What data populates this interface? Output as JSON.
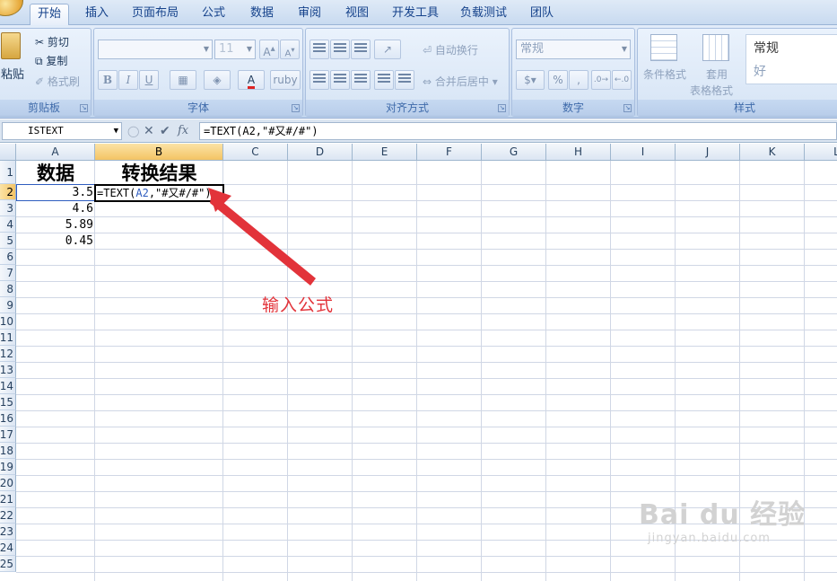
{
  "tabs": [
    "开始",
    "插入",
    "页面布局",
    "公式",
    "数据",
    "审阅",
    "视图",
    "开发工具",
    "负载测试",
    "团队"
  ],
  "ribbon": {
    "clipboard": {
      "paste": "粘贴",
      "cut": "剪切",
      "copy": "复制",
      "format_painter": "格式刷",
      "title": "剪贴板"
    },
    "font": {
      "size": "11",
      "title": "字体",
      "bold": "B",
      "italic": "I",
      "underline": "U"
    },
    "alignment": {
      "wrap": "自动换行",
      "merge": "合并后居中",
      "title": "对齐方式"
    },
    "number": {
      "format": "常规",
      "percent": "%",
      "comma": ",",
      "title": "数字"
    },
    "styles": {
      "conditional": "条件格式",
      "table_1": "套用",
      "table_2": "表格格式",
      "normal": "常规",
      "good": "好",
      "title": "样式"
    }
  },
  "formula_bar": {
    "name_box": "ISTEXT",
    "fx": "fx",
    "formula": "=TEXT(A2,\"#又#/#\")"
  },
  "columns": [
    "A",
    "B",
    "C",
    "D",
    "E",
    "F",
    "G",
    "H",
    "I",
    "J",
    "K",
    "L"
  ],
  "rows": [
    "1",
    "2",
    "3",
    "4",
    "5",
    "6",
    "7",
    "8",
    "9",
    "10",
    "11",
    "12",
    "13",
    "14",
    "15",
    "16",
    "17",
    "18",
    "19",
    "20",
    "21",
    "22",
    "23",
    "24",
    "25"
  ],
  "cells": {
    "a1": "数据",
    "b1": "转换结果",
    "a2": "3.5",
    "a3": "4.6",
    "a4": "5.89",
    "a5": "0.45",
    "b2_prefix": "=TEXT(",
    "b2_ref": "A2",
    "b2_suffix": ",\"#又#/#\")"
  },
  "annotation": "输入公式",
  "watermark": {
    "brand": "Bai du 经验",
    "url": "jingyan.baidu.com"
  },
  "colors": {
    "selection_header": "#f4c464",
    "annotation": "#e2333a",
    "reference": "#2f5dbf"
  }
}
